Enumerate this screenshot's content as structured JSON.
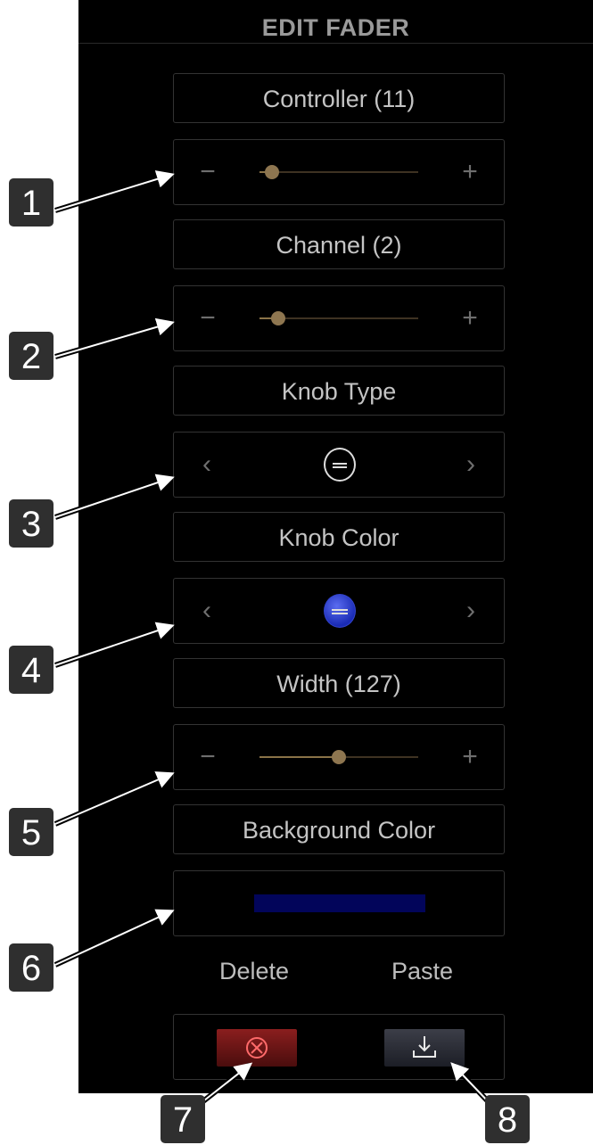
{
  "header": {
    "title": "EDIT FADER"
  },
  "controller": {
    "label": "Controller (11)",
    "minus": "−",
    "plus": "+",
    "level": 0.08
  },
  "channel": {
    "label": "Channel (2)",
    "minus": "−",
    "plus": "+",
    "level": 0.12
  },
  "knob_type": {
    "label": "Knob Type",
    "prev": "‹",
    "next": "›",
    "icon": "knob-white-icon"
  },
  "knob_color": {
    "label": "Knob Color",
    "prev": "‹",
    "next": "›",
    "icon": "knob-blue-icon",
    "color": "#2233cc"
  },
  "width": {
    "label": "Width (127)",
    "minus": "−",
    "plus": "+",
    "level": 0.5
  },
  "background_color": {
    "label": "Background Color",
    "color": "#02055a"
  },
  "actions": {
    "delete_label": "Delete",
    "paste_label": "Paste"
  },
  "buttons": {
    "delete_icon": "close-circle-icon",
    "paste_icon": "download-tray-icon"
  },
  "callouts": [
    "1",
    "2",
    "3",
    "4",
    "5",
    "6",
    "7",
    "8"
  ],
  "colors": {
    "accent": "#8e7650",
    "panel": "#000000"
  }
}
